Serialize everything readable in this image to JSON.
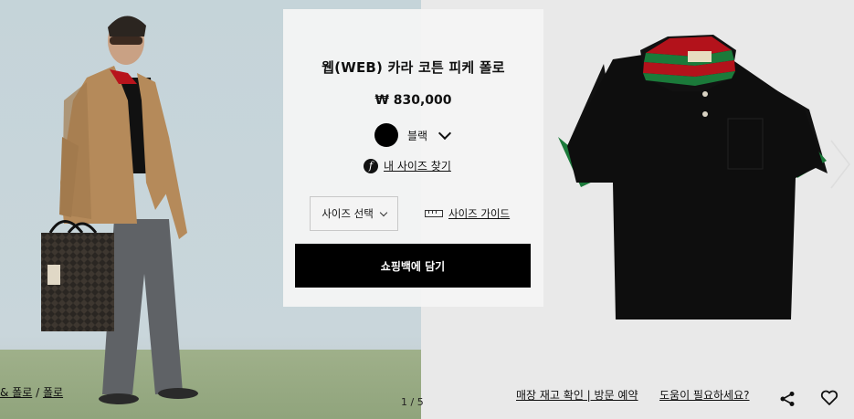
{
  "product": {
    "title": "웹(WEB) 카라 코튼 피케 폴로",
    "price": "₩ 830,000",
    "color": {
      "label": "블랙",
      "swatch": "#000000"
    },
    "my_size_link": "내 사이즈 찾기",
    "size_select_label": "사이즈 선택",
    "size_guide_label": "사이즈 가이드",
    "add_to_bag_label": "쇼핑백에 담기"
  },
  "gallery": {
    "pager": "1 / 5"
  },
  "breadcrumb": {
    "prefix": "& 폴로",
    "separator": "/",
    "last": "폴로"
  },
  "footer": {
    "store_check": "매장 재고 확인 | 방문 예약",
    "help": "도움이 필요하세요?"
  },
  "icons": [
    "f-logo-icon",
    "chevron-down-icon",
    "ruler-icon",
    "share-icon",
    "heart-icon",
    "chevron-right-icon"
  ]
}
